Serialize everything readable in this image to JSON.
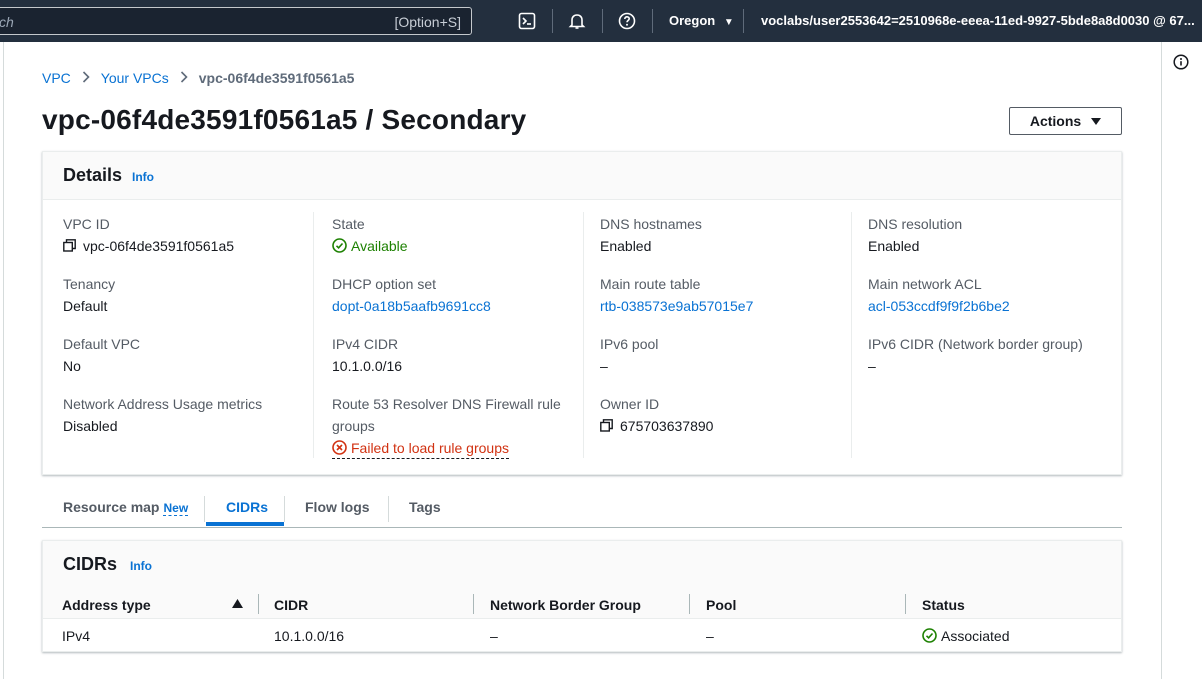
{
  "topnav": {
    "search_placeholder": "ch",
    "search_shortcut": "[Option+S]",
    "region": "Oregon",
    "account": "voclabs/user2553642=2510968e-eeea-11ed-9927-5bde8a8d0030 @ 67..."
  },
  "breadcrumb": {
    "items": [
      "VPC",
      "Your VPCs"
    ],
    "current": "vpc-06f4de3591f0561a5"
  },
  "page": {
    "title": "vpc-06f4de3591f0561a5 / Secondary",
    "actions_label": "Actions"
  },
  "details": {
    "title": "Details",
    "info": "Info",
    "fields": {
      "vpc_id_label": "VPC ID",
      "vpc_id": "vpc-06f4de3591f0561a5",
      "state_label": "State",
      "state": "Available",
      "dns_hostnames_label": "DNS hostnames",
      "dns_hostnames": "Enabled",
      "dns_resolution_label": "DNS resolution",
      "dns_resolution": "Enabled",
      "tenancy_label": "Tenancy",
      "tenancy": "Default",
      "dhcp_label": "DHCP option set",
      "dhcp": "dopt-0a18b5aafb9691cc8",
      "main_route_label": "Main route table",
      "main_route": "rtb-038573e9ab57015e7",
      "main_acl_label": "Main network ACL",
      "main_acl": "acl-053ccdf9f9f2b6be2",
      "default_vpc_label": "Default VPC",
      "default_vpc": "No",
      "ipv4_cidr_label": "IPv4 CIDR",
      "ipv4_cidr": "10.1.0.0/16",
      "ipv6_pool_label": "IPv6 pool",
      "ipv6_pool": "–",
      "ipv6_cidr_label": "IPv6 CIDR (Network border group)",
      "ipv6_cidr": "–",
      "nau_label": "Network Address Usage metrics",
      "nau": "Disabled",
      "r53_label_line1": "Route 53 Resolver DNS Firewall rule",
      "r53_label_line2": "groups",
      "r53_value": "Failed to load rule groups",
      "owner_label": "Owner ID",
      "owner": "675703637890"
    }
  },
  "tabs": {
    "resource_map": "Resource map",
    "new_badge": "New",
    "cidrs": "CIDRs",
    "flow_logs": "Flow logs",
    "tags": "Tags"
  },
  "cidrs_panel": {
    "title": "CIDRs",
    "info": "Info",
    "columns": [
      "Address type",
      "CIDR",
      "Network Border Group",
      "Pool",
      "Status"
    ],
    "rows": [
      {
        "address_type": "IPv4",
        "cidr": "10.1.0.0/16",
        "nbg": "–",
        "pool": "–",
        "status": "Associated"
      }
    ]
  },
  "colors": {
    "nav_bg": "#232f3e",
    "link": "#0972d3",
    "success": "#1d8102",
    "error": "#d13212"
  }
}
